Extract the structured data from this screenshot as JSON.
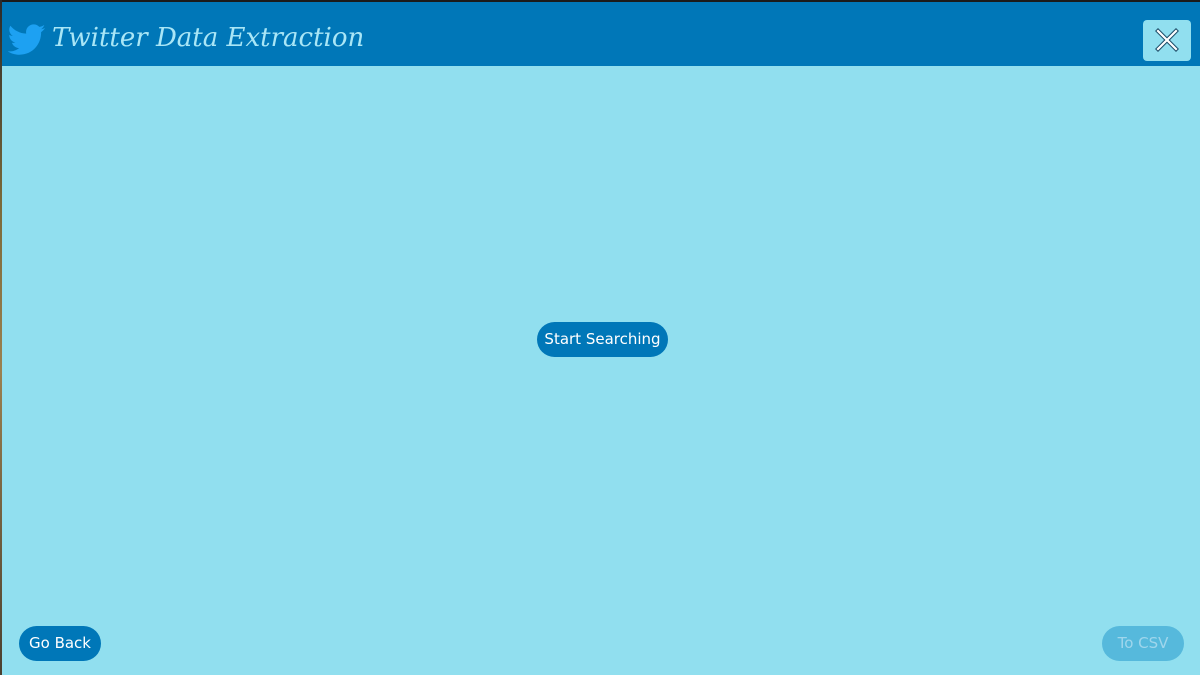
{
  "window": {
    "title": "Twitter Data Extraction",
    "logo_icon": "twitter-bird-icon",
    "close_icon": "close-icon"
  },
  "main": {
    "start_label": "Start Searching"
  },
  "footer": {
    "back_label": "Go Back",
    "csv_label": "To CSV",
    "csv_enabled": false
  },
  "colors": {
    "header": "#0077b8",
    "background": "#91dfef",
    "button": "#0077b8",
    "button_disabled": "#56b9dc",
    "title_text": "#a9e6f6"
  }
}
